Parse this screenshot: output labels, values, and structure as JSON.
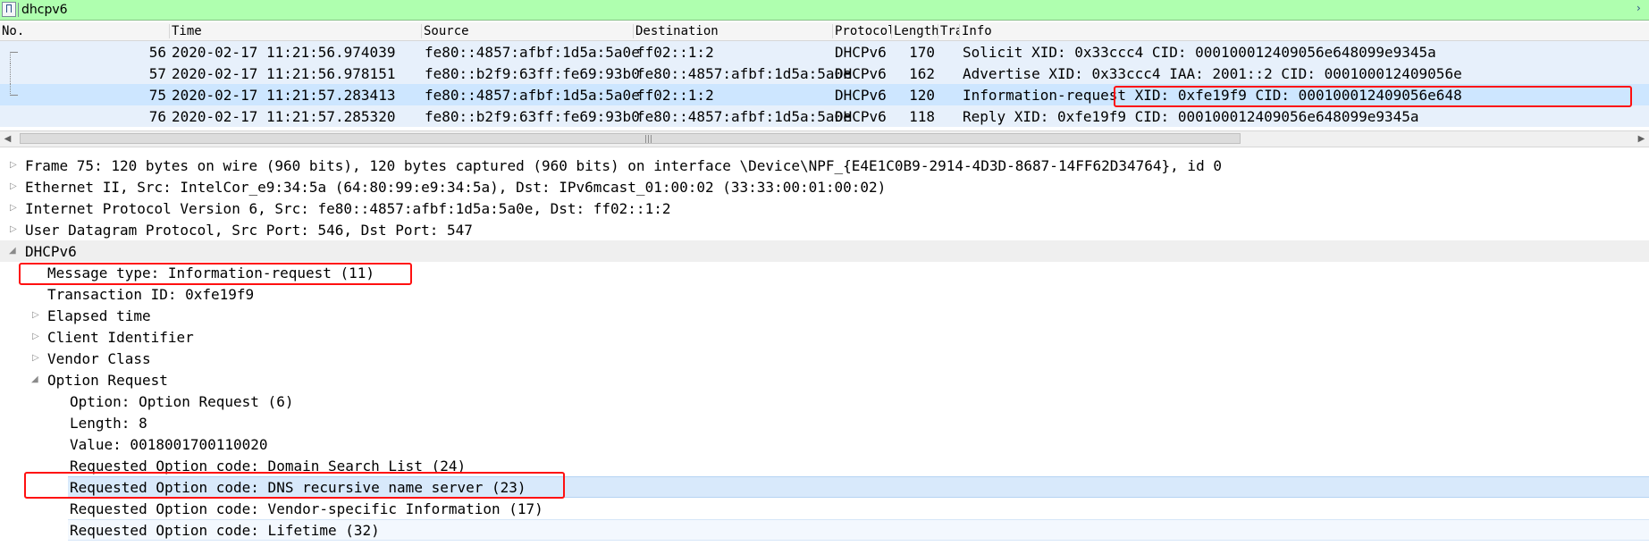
{
  "filter": {
    "value": "dhcpv6",
    "bookmark_icon": "bookmark-icon",
    "arrow_icon": "chevron-right-icon"
  },
  "packet_list": {
    "columns": [
      "No.",
      "Time",
      "Source",
      "Destination",
      "Protocol",
      "Length",
      "Tra",
      "Info"
    ],
    "rows": [
      {
        "no": "56",
        "time": "2020-02-17 11:21:56.974039",
        "source": "fe80::4857:afbf:1d5a:5a0e",
        "destination": "ff02::1:2",
        "protocol": "DHCPv6",
        "length": "170",
        "info": "Solicit XID: 0x33ccc4 CID: 000100012409056e648099e9345a"
      },
      {
        "no": "57",
        "time": "2020-02-17 11:21:56.978151",
        "source": "fe80::b2f9:63ff:fe69:93b0",
        "destination": "fe80::4857:afbf:1d5a:5a0e",
        "protocol": "DHCPv6",
        "length": "162",
        "info": "Advertise XID: 0x33ccc4 IAA: 2001::2 CID: 000100012409056e"
      },
      {
        "no": "75",
        "time": "2020-02-17 11:21:57.283413",
        "source": "fe80::4857:afbf:1d5a:5a0e",
        "destination": "ff02::1:2",
        "protocol": "DHCPv6",
        "length": "120",
        "info": "Information-request XID: 0xfe19f9 CID: 000100012409056e648"
      },
      {
        "no": "76",
        "time": "2020-02-17 11:21:57.285320",
        "source": "fe80::b2f9:63ff:fe69:93b0",
        "destination": "fe80::4857:afbf:1d5a:5a0e",
        "protocol": "DHCPv6",
        "length": "118",
        "info": "Reply XID: 0xfe19f9 CID: 000100012409056e648099e9345a"
      }
    ],
    "scroll_grip": "|||"
  },
  "details": {
    "frame": "Frame 75: 120 bytes on wire (960 bits), 120 bytes captured (960 bits) on interface \\Device\\NPF_{E4E1C0B9-2914-4D3D-8687-14FF62D34764}, id 0",
    "ethernet": "Ethernet II, Src: IntelCor_e9:34:5a (64:80:99:e9:34:5a), Dst: IPv6mcast_01:00:02 (33:33:00:01:00:02)",
    "ipv6": "Internet Protocol Version 6, Src: fe80::4857:afbf:1d5a:5a0e, Dst: ff02::1:2",
    "udp": "User Datagram Protocol, Src Port: 546, Dst Port: 547",
    "dhcpv6": "DHCPv6",
    "message_type": "Message type: Information-request (11)",
    "transaction_id": "Transaction ID: 0xfe19f9",
    "elapsed_time": "Elapsed time",
    "client_identifier": "Client Identifier",
    "vendor_class": "Vendor Class",
    "option_request": "Option Request",
    "option": "Option: Option Request (6)",
    "length": "Length: 8",
    "value": "Value: 0018001700110020",
    "req_domain_search": "Requested Option code: Domain Search List (24)",
    "req_dns": "Requested Option code: DNS recursive name server (23)",
    "req_vendor": "Requested Option code: Vendor-specific Information (17)",
    "req_lifetime": "Requested Option code: Lifetime (32)"
  },
  "glyphs": {
    "expand": "▷",
    "collapse": "◢",
    "scroll_left": "◀",
    "scroll_right": "▶"
  },
  "colors": {
    "filter_bg": "#afffaf",
    "highlight_box": "#ff1010",
    "row_bg": "#e7f0fb",
    "row_selected": "#cde6ff"
  }
}
